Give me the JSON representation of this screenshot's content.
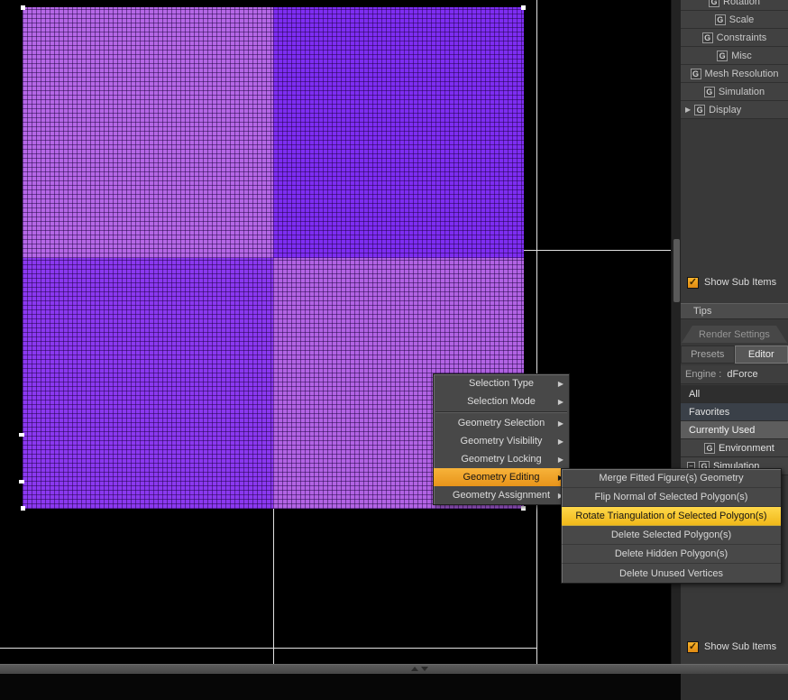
{
  "icons": {
    "g": "G",
    "arrow_right": "▶",
    "check": "✓",
    "collapse": "−",
    "grip": "⌃⌄"
  },
  "colors": {
    "menu_highlight_orange": "#f2a52e",
    "submenu_highlight_yellow": "#f7c71f",
    "checkbox_orange": "#ef9f1c",
    "mesh_purple_light": "#b567e6",
    "mesh_purple_dark": "#7e2df2"
  },
  "panel": {
    "param_groups": [
      {
        "label": "Rotation"
      },
      {
        "label": "Scale"
      },
      {
        "label": "Constraints"
      },
      {
        "label": "Misc"
      },
      {
        "label": "Mesh Resolution"
      },
      {
        "label": "Simulation"
      },
      {
        "label": "Display"
      }
    ],
    "show_sub_items_top": "Show Sub Items",
    "tips_label": "Tips",
    "render_settings_title": "Render Settings",
    "tabs": [
      {
        "label": "Presets"
      },
      {
        "label": "Editor"
      }
    ],
    "engine_label": "Engine :",
    "engine_value": "dForce",
    "filter_rows": [
      {
        "label": "All"
      },
      {
        "label": "Favorites"
      },
      {
        "label": "Currently Used"
      },
      {
        "label": "Environment"
      },
      {
        "label": "Simulation"
      }
    ],
    "show_sub_items_bottom": "Show Sub Items"
  },
  "context_menu": {
    "items": [
      {
        "label": "Selection Type"
      },
      {
        "label": "Selection Mode"
      },
      {
        "label": "Geometry Selection"
      },
      {
        "label": "Geometry Visibility"
      },
      {
        "label": "Geometry Locking"
      },
      {
        "label": "Geometry Editing"
      },
      {
        "label": "Geometry Assignment"
      }
    ]
  },
  "submenu": {
    "items": [
      {
        "label": "Merge Fitted Figure(s) Geometry"
      },
      {
        "label": "Flip Normal of Selected Polygon(s)"
      },
      {
        "label": "Rotate Triangulation of Selected Polygon(s)"
      },
      {
        "label": "Delete Selected Polygon(s)"
      },
      {
        "label": "Delete Hidden Polygon(s)"
      },
      {
        "label": "Delete Unused Vertices"
      }
    ]
  }
}
